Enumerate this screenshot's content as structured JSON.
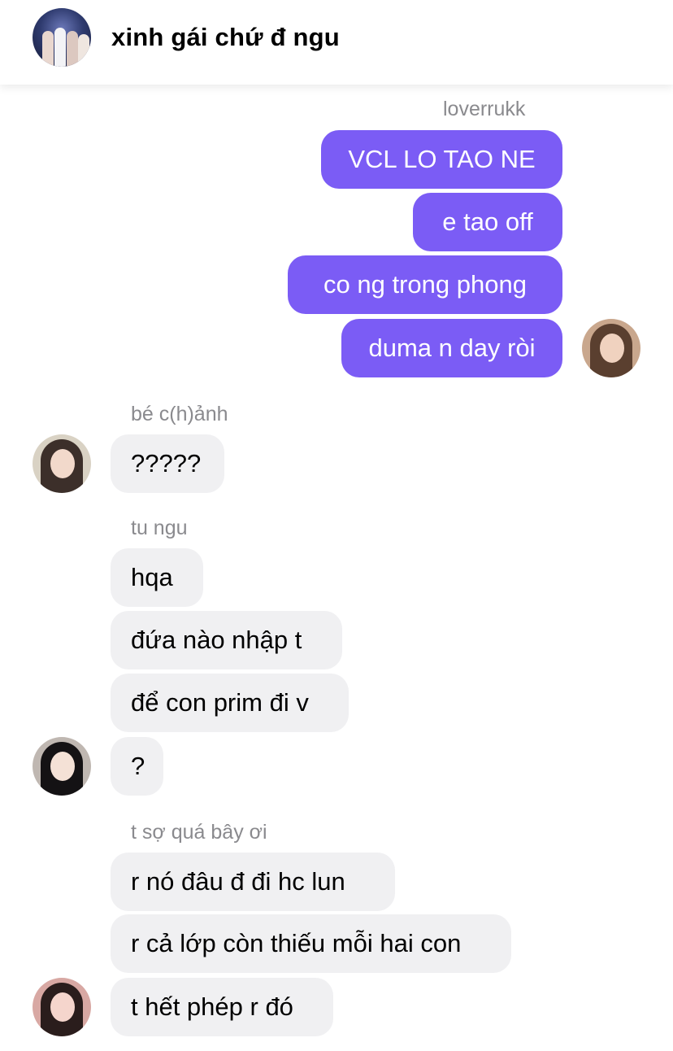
{
  "header": {
    "title": "xinh gái chứ đ ngu",
    "avatar_icon": "group-photo-avatar"
  },
  "messages": [
    {
      "sender": "loverrukk",
      "direction": "outgoing",
      "bubbles": [
        "VCL LO TAO NE",
        "e tao off",
        "co ng trong phong",
        "duma n day ròi"
      ]
    },
    {
      "sender": "bé c(h)ảnh",
      "direction": "incoming",
      "bubbles": [
        "?????"
      ]
    },
    {
      "sender": "tu ngu",
      "direction": "incoming",
      "bubbles": [
        "hqa",
        "đứa nào nhập t",
        "để con prim đi v",
        "?"
      ]
    },
    {
      "sender": "t sợ quá bây ơi",
      "direction": "incoming",
      "bubbles": [
        "r nó đâu đ đi hc lun",
        "r cả lớp còn thiếu mỗi hai con",
        "t hết phép r đó"
      ]
    }
  ],
  "colors": {
    "outgoing_bubble": "#7b5cf5",
    "incoming_bubble": "#f0f0f2",
    "sender_label": "#8a8a8e"
  }
}
